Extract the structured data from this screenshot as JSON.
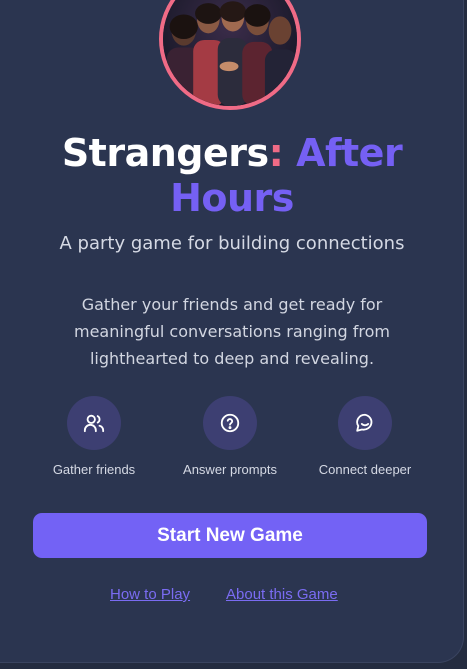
{
  "hero": {
    "image_icon": "group-of-friends-photo"
  },
  "title": {
    "part1": "Strangers",
    "colon": ":",
    "part2": "After Hours"
  },
  "tagline": "A party game for building connections",
  "description": "Gather your friends and get ready for meaningful conversations ranging from lighthearted to deep and revealing.",
  "features": [
    {
      "icon": "users-icon",
      "label": "Gather friends"
    },
    {
      "icon": "question-circle-icon",
      "label": "Answer prompts"
    },
    {
      "icon": "chat-bubble-icon",
      "label": "Connect deeper"
    }
  ],
  "actions": {
    "start_label": "Start New Game",
    "how_to_play": "How to Play",
    "about": "About this Game"
  },
  "colors": {
    "background": "#2b3550",
    "accent": "#7362f5",
    "pink": "#f06b86",
    "icon_circle": "#3d3f72"
  }
}
